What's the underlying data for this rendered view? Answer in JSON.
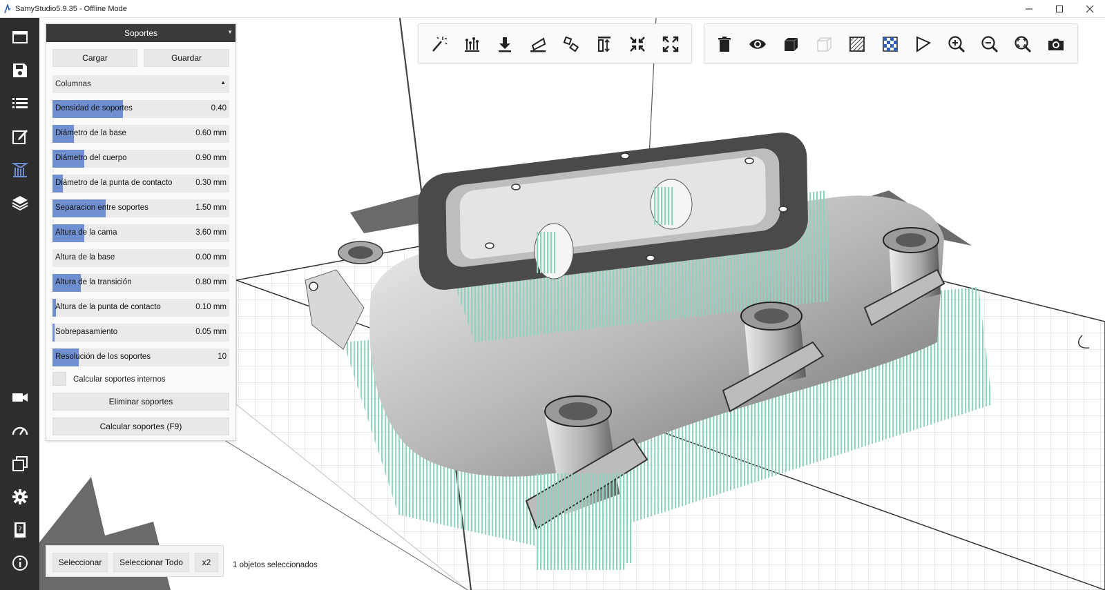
{
  "window": {
    "title": "SamyStudio5.9.35 - Offline Mode"
  },
  "sidebar": {
    "items": [
      {
        "icon": "window-icon"
      },
      {
        "icon": "save-icon"
      },
      {
        "icon": "list-icon"
      },
      {
        "icon": "edit-icon"
      },
      {
        "icon": "supports-icon",
        "active": true
      },
      {
        "icon": "layers-icon"
      },
      {
        "icon": "camera-icon"
      },
      {
        "icon": "speedometer-icon"
      },
      {
        "icon": "copies-icon"
      },
      {
        "icon": "settings-gear-icon"
      },
      {
        "icon": "manual-book-icon"
      },
      {
        "icon": "info-icon"
      }
    ]
  },
  "panel": {
    "title": "Soportes",
    "load_label": "Cargar",
    "save_label": "Guardar",
    "support_type": "Columnas",
    "params": [
      {
        "label": "Densidad de soportes",
        "value": "0.40",
        "fill": 0.4
      },
      {
        "label": "Diámetro de la base",
        "value": "0.60 mm",
        "fill": 0.12
      },
      {
        "label": "Diámetro del cuerpo",
        "value": "0.90 mm",
        "fill": 0.18
      },
      {
        "label": "Diámetro de la punta de contacto",
        "value": "0.30 mm",
        "fill": 0.06
      },
      {
        "label": "Separacion entre soportes",
        "value": "1.50 mm",
        "fill": 0.3
      },
      {
        "label": "Altura de la cama",
        "value": "3.60 mm",
        "fill": 0.18
      },
      {
        "label": "Altura de la base",
        "value": "0.00 mm",
        "fill": 0.0
      },
      {
        "label": "Altura de la transición",
        "value": "0.80 mm",
        "fill": 0.16
      },
      {
        "label": "Altura de la punta de contacto",
        "value": "0.10 mm",
        "fill": 0.02
      },
      {
        "label": "Sobrepasamiento",
        "value": "0.05 mm",
        "fill": 0.01
      },
      {
        "label": "Resolución de los soportes",
        "value": "10",
        "fill": 0.15
      }
    ],
    "internal_supports_label": "Calcular soportes internos",
    "internal_supports_checked": false,
    "delete_label": "Eliminar soportes",
    "compute_label": "Calcular soportes (F9)"
  },
  "toolbar_left": {
    "tools": [
      "magic-wand-icon",
      "support-lines-icon",
      "drop-to-bed-icon",
      "lay-flat-icon",
      "rotate-icon",
      "scale-height-icon",
      "shrink-icon",
      "expand-icon"
    ]
  },
  "toolbar_right": {
    "tools": [
      "trash-icon",
      "eye-icon",
      "cube-solid-icon",
      "cube-ghost-icon",
      "hatch-icon",
      "checker-icon",
      "flag-icon",
      "zoom-in-icon",
      "zoom-out-icon",
      "zoom-fit-icon",
      "screenshot-camera-icon"
    ]
  },
  "bottom": {
    "select_label": "Seleccionar",
    "select_all_label": "Seleccionar Todo",
    "multiplier_label": "x2",
    "status": "1 objetos seleccionados"
  },
  "colors": {
    "sidebar_bg": "#2d2d2d",
    "accent": "#6f8fd0",
    "support_color": "#8fd2c0",
    "panel_header": "#3a3a3a"
  }
}
